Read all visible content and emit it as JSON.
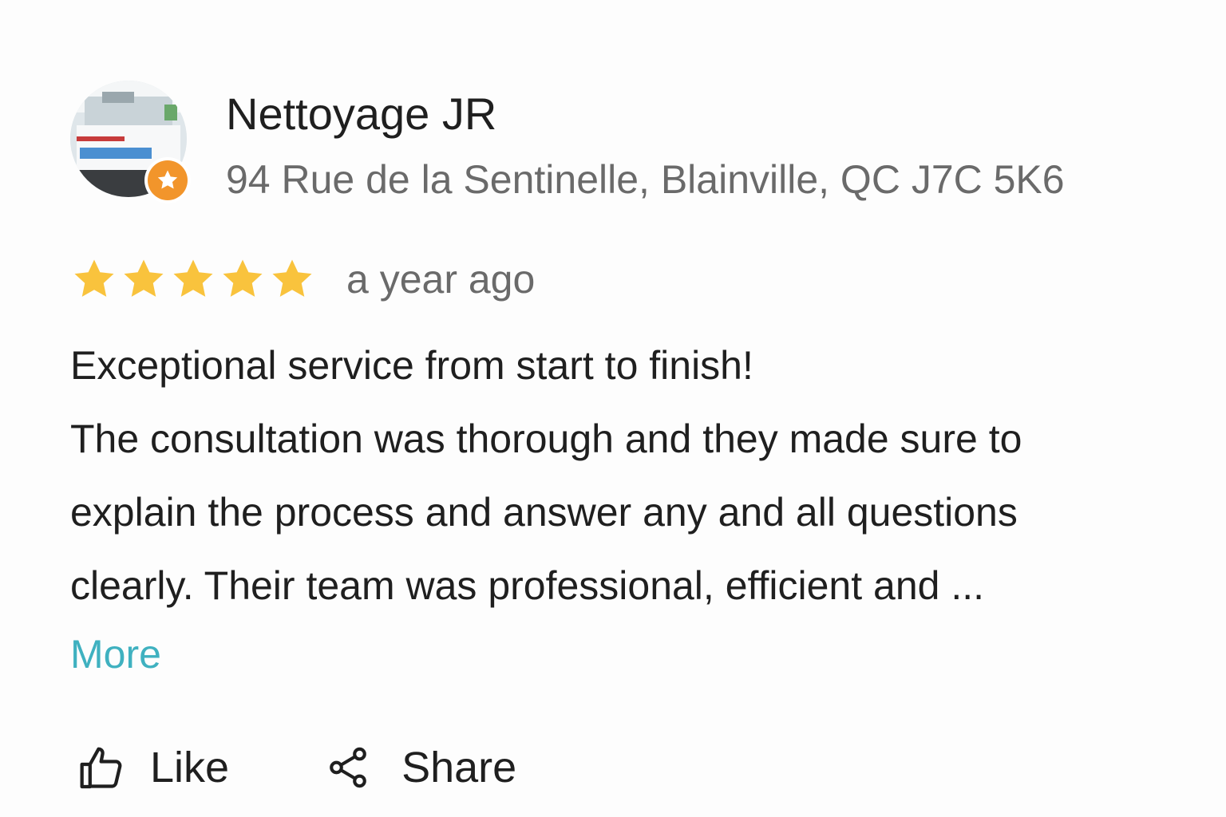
{
  "business": {
    "name": "Nettoyage JR",
    "address": "94 Rue de la Sentinelle, Blainville, QC J7C 5K6",
    "avatar_icon": "business-photo",
    "badge_icon": "local-guide-star-icon",
    "badge_color": "#f2952b"
  },
  "review": {
    "rating": 5,
    "rating_max": 5,
    "star_color": "#f9c33d",
    "time": "a year ago",
    "lines": [
      "Exceptional service from start to finish!",
      "The consultation was thorough and they made sure to",
      "explain the process and answer any and all questions",
      "clearly. Their team was professional, efficient and ..."
    ],
    "more_label": "More",
    "more_color": "#3fb1c0"
  },
  "actions": {
    "like_label": "Like",
    "like_icon": "thumbs-up-icon",
    "share_label": "Share",
    "share_icon": "share-icon"
  }
}
